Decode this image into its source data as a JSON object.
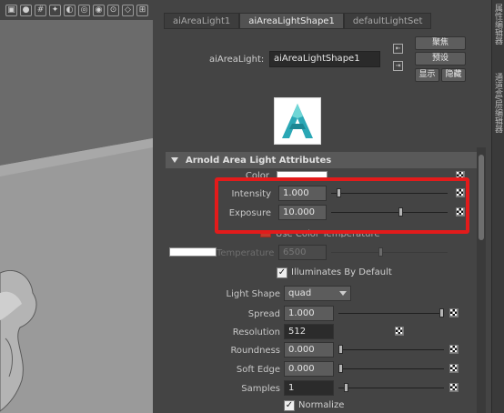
{
  "viewport": {
    "toolbar_icons": [
      "wireframe-icon",
      "smooth-shade-icon",
      "grid-icon",
      "light-icon",
      "shadow-icon",
      "camera-icon",
      "isolate-icon",
      "hud-icon",
      "xray-icon",
      "joints-icon"
    ]
  },
  "tabs": [
    {
      "label": "aiAreaLight1"
    },
    {
      "label": "aiAreaLightShape1"
    },
    {
      "label": "defaultLightSet"
    }
  ],
  "node": {
    "label": "aiAreaLight:",
    "value": "aiAreaLightShape1"
  },
  "buttons": {
    "focus": "聚焦",
    "presets": "预设",
    "show": "显示",
    "hide": "隐藏"
  },
  "side_strip": {
    "label1": "属性编辑器",
    "label2": "通道盒/层编辑器"
  },
  "section": {
    "title": "Arnold Area Light Attributes"
  },
  "attrs": {
    "color": {
      "label": "Color"
    },
    "intensity": {
      "label": "Intensity",
      "value": "1.000",
      "slider_fraction": 0.05
    },
    "exposure": {
      "label": "Exposure",
      "value": "10.000",
      "slider_fraction": 0.6
    },
    "use_color_temperature": {
      "label": "Use Color Temperature",
      "checked": false
    },
    "temperature": {
      "label": "Temperature",
      "value": "6500",
      "slider_fraction": 0.42
    },
    "illuminates_by_default": {
      "label": "Illuminates By Default",
      "checked": true
    },
    "light_shape": {
      "label": "Light Shape",
      "value": "quad"
    },
    "spread": {
      "label": "Spread",
      "value": "1.000",
      "slider_fraction": 1.0
    },
    "resolution": {
      "label": "Resolution",
      "value": "512"
    },
    "roundness": {
      "label": "Roundness",
      "value": "0.000",
      "slider_fraction": 0.0
    },
    "soft_edge": {
      "label": "Soft Edge",
      "value": "0.000",
      "slider_fraction": 0.0
    },
    "samples": {
      "label": "Samples",
      "value": "1",
      "slider_fraction": 0.05
    },
    "normalize": {
      "label": "Normalize",
      "checked": true
    }
  },
  "colors": {
    "highlight": "#e31b1b",
    "panel": "#444444",
    "header": "#595959"
  }
}
